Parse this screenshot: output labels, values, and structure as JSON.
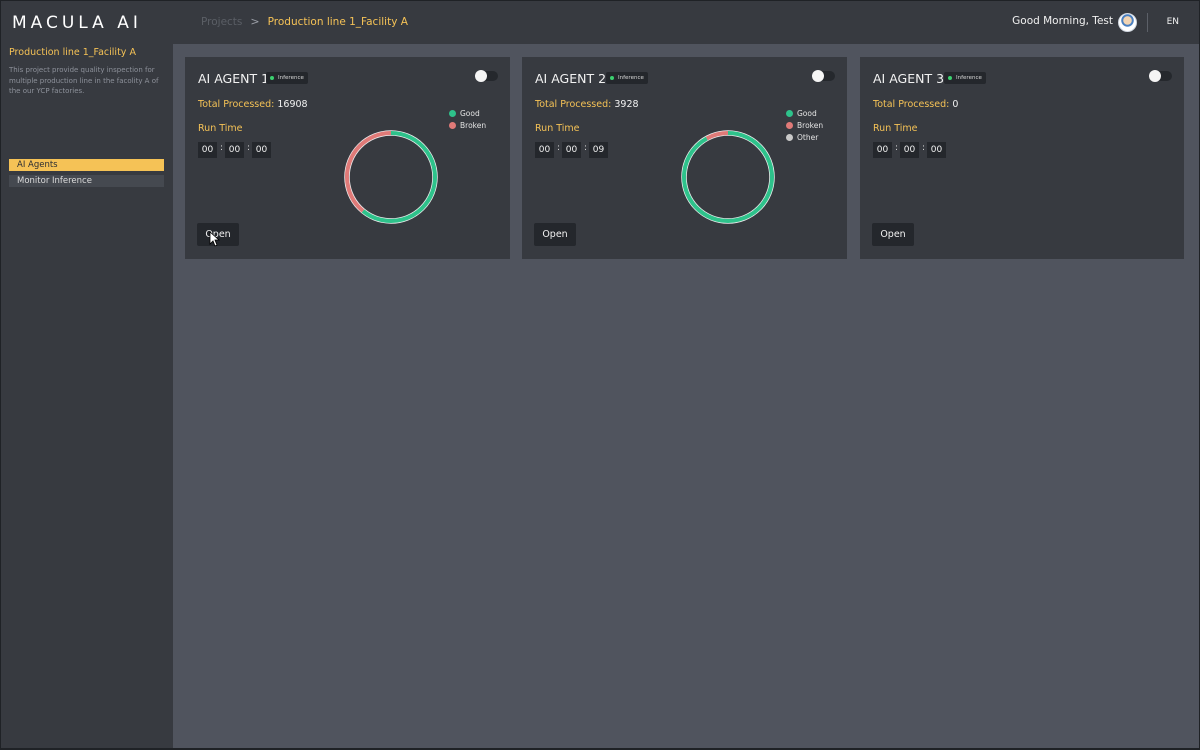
{
  "header": {
    "logo": "MACULA AI",
    "breadcrumb_root": "Projects",
    "breadcrumb_separator": ">",
    "breadcrumb_current": "Production line 1_Facility A",
    "greeting": "Good Morning, Test",
    "language": "EN"
  },
  "sidebar": {
    "project_title": "Production line 1_Facility A",
    "project_description": "This project provide quality inspection for multiple production line in the facolity A of the our YCP factories.",
    "items": [
      {
        "label": "AI Agents",
        "active": true
      },
      {
        "label": "Monitor Inference",
        "active": false
      }
    ]
  },
  "colors": {
    "accent": "#f5c256",
    "good": "#2ec28b",
    "broken": "#e07a78",
    "other": "#c9c9c9",
    "status_dot": "#3bd16f"
  },
  "agents": [
    {
      "title": "AI AGENT 1",
      "badge": "Inference",
      "enabled": false,
      "processed_label": "Total Processed:",
      "processed_value": "16908",
      "runtime_label": "Run Time",
      "runtime": [
        "00",
        "00",
        "00"
      ],
      "open_label": "Open",
      "chart_visible": true,
      "legend": [
        "Good",
        "Broken"
      ],
      "chart_data": {
        "type": "pie",
        "labels": [
          "Good",
          "Broken"
        ],
        "values": [
          61,
          39
        ]
      }
    },
    {
      "title": "AI AGENT 2",
      "badge": "Inference",
      "enabled": false,
      "processed_label": "Total Processed:",
      "processed_value": "3928",
      "runtime_label": "Run Time",
      "runtime": [
        "00",
        "00",
        "09"
      ],
      "open_label": "Open",
      "chart_visible": true,
      "legend": [
        "Good",
        "Broken",
        "Other"
      ],
      "chart_data": {
        "type": "pie",
        "labels": [
          "Good",
          "Broken",
          "Other"
        ],
        "values": [
          92,
          8,
          0
        ]
      }
    },
    {
      "title": "AI AGENT 3",
      "badge": "Inference",
      "enabled": false,
      "processed_label": "Total Processed:",
      "processed_value": "0",
      "runtime_label": "Run Time",
      "runtime": [
        "00",
        "00",
        "00"
      ],
      "open_label": "Open",
      "chart_visible": false,
      "legend": [],
      "chart_data": null
    }
  ]
}
